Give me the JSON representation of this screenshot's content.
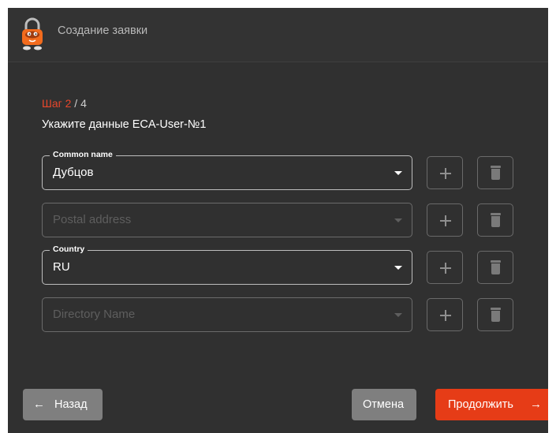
{
  "window": {
    "title": "Создание заявки"
  },
  "step": {
    "label": "Шаг",
    "current": "2",
    "separator": " / ",
    "total": "4"
  },
  "subtitle": "Укажите данные ECA-User-№1",
  "fields": [
    {
      "legend": "Common name",
      "value": "Дубцов",
      "placeholder": ""
    },
    {
      "legend": "",
      "value": "",
      "placeholder": "Postal address"
    },
    {
      "legend": "Country",
      "value": "RU",
      "placeholder": ""
    },
    {
      "legend": "",
      "value": "",
      "placeholder": "Directory Name"
    }
  ],
  "buttons": {
    "back": "Назад",
    "cancel": "Отмена",
    "next": "Продолжить"
  },
  "icons": {
    "logo": "lock-character-logo",
    "add": "plus-icon",
    "delete": "trash-icon",
    "back_arrow": "arrow-left-icon",
    "next_arrow": "arrow-right-icon",
    "dropdown": "chevron-down-icon"
  },
  "colors": {
    "accent": "#e63c17",
    "background": "#303030",
    "secondary_button": "#7f7f7f"
  }
}
